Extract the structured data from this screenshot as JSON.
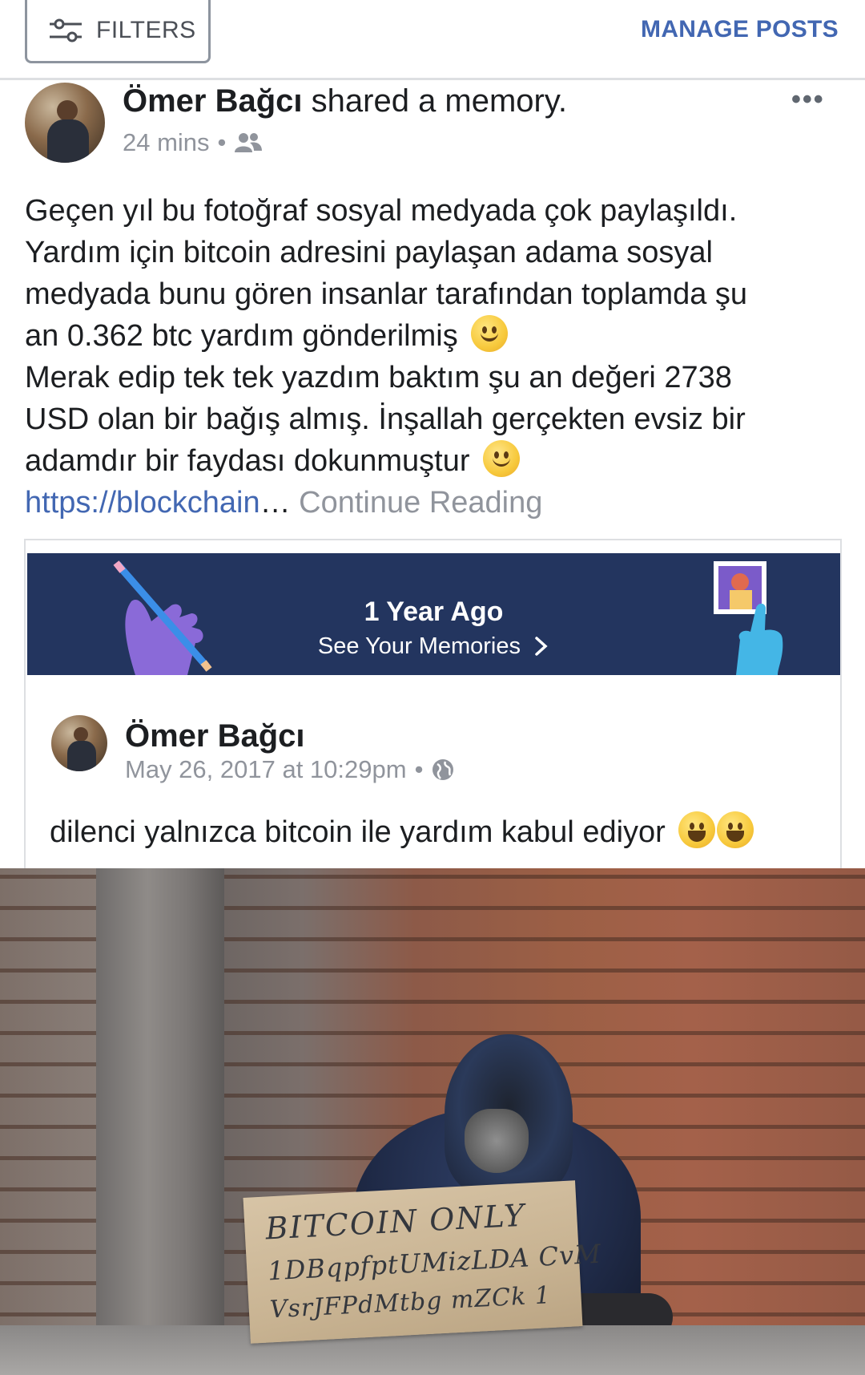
{
  "toolbar": {
    "filters_label": "FILTERS",
    "manage_posts_label": "MANAGE POSTS"
  },
  "post": {
    "author": "Ömer Bağcı",
    "action": " shared a memory.",
    "time": "24 mins",
    "audience_icon": "friends-icon",
    "more_icon": "more-options-icon",
    "text_lines": [
      "Geçen yıl bu fotoğraf sosyal medyada çok paylaşıldı.",
      "Yardım için bitcoin adresini paylaşan adama sosyal",
      "medyada bunu gören insanlar tarafından toplamda şu",
      "an 0.362 btc yardım gönderilmiş",
      "Merak edip tek tek yazdım baktım şu an değeri 2738",
      "USD olan bir bağış almış. İnşallah gerçekten evsiz bir",
      "adamdır bir faydası dokunmuştur"
    ],
    "link": "https://blockchain",
    "ellipsis": "…",
    "continue_reading": " Continue Reading"
  },
  "memory": {
    "banner_title": "1 Year Ago",
    "banner_sub": "See Your Memories",
    "chevron_icon": "chevron-right-icon"
  },
  "shared_post": {
    "author": "Ömer Bağcı",
    "date": "May 26, 2017 at 10:29pm",
    "audience_icon": "globe-icon",
    "text": "dilenci yalnızca bitcoin ile yardım kabul ediyor"
  },
  "photo": {
    "sign_lines": [
      "BITCOIN ONLY",
      "1DBqpfptUMizLDA CvM",
      "VsrJFPdMtbg mZCk 1"
    ]
  },
  "colors": {
    "link": "#4267b2",
    "muted": "#90949c",
    "banner": "#23355f"
  }
}
